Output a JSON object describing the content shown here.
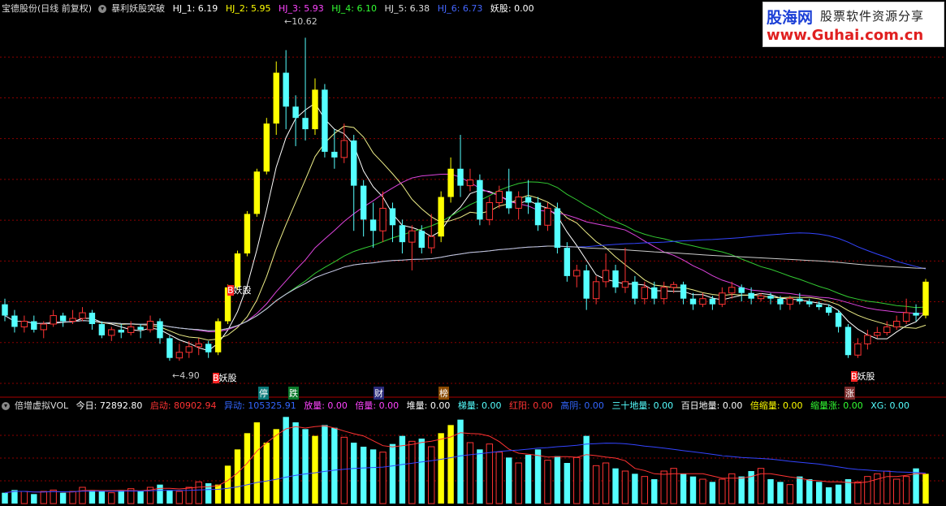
{
  "header": {
    "stock_name": "宝德股份(日线 前复权)",
    "menu_icon": "circle-menu-icon",
    "indicator_name": "暴利妖股突破",
    "hj1": {
      "label": "HJ_1: 6.19",
      "color": "#ffffff"
    },
    "hj2": {
      "label": "HJ_2: 5.95",
      "color": "#ffff00"
    },
    "hj3": {
      "label": "HJ_3: 5.93",
      "color": "#ff44ff"
    },
    "hj4": {
      "label": "HJ_4: 6.10",
      "color": "#33ff33"
    },
    "hj5": {
      "label": "HJ_5: 6.38",
      "color": "#dddddd"
    },
    "hj6": {
      "label": "HJ_6: 6.73",
      "color": "#4466ff"
    },
    "yaogu": {
      "label": "妖股: 0.00",
      "color": "#ffffff"
    }
  },
  "logo": {
    "line1": "股海网",
    "line2": "股票软件资源分享",
    "line3": "www.Guhai.com.cn"
  },
  "annotations": {
    "high_price": "10.62",
    "low_price": "4.90",
    "signal_yaogu": "妖股",
    "signal_b": "B",
    "tag_ting": "停",
    "tag_die": "跌",
    "tag_cai": "财",
    "tag_bang": "榜",
    "tag_zhang": "涨"
  },
  "volume_header": {
    "name": "倍增虚拟VOL",
    "today": "今日: 72892.80",
    "qidong": "启动: 80902.94",
    "yidong": "异动: 105325.91",
    "fangliang": "放量: 0.00",
    "beiliang": "倍量: 0.00",
    "duiliang": "堆量: 0.00",
    "tiliang": "梯量: 0.00",
    "hongyang": "红阳: 0.00",
    "gaoyin": "高阴: 0.00",
    "sanshi": "三十地量: 0.00",
    "baiday": "百日地量: 0.00",
    "beisuo": "倍缩量: 0.00",
    "suozhang": "缩量涨: 0.00",
    "xg": "XG: 0.00"
  },
  "colors": {
    "up": "#ff3333",
    "down": "#55ffff",
    "yellow": "#ffff00",
    "ma_white": "#ffffff",
    "ma_yellow": "#eeee88",
    "ma_magenta": "#dd44dd",
    "ma_green": "#33cc33",
    "ma_blue": "#3344ff",
    "ma_long": "#cccccc",
    "grid": "#8b0000"
  },
  "chart_data": {
    "type": "candlestick",
    "price_range": [
      4.5,
      11.0
    ],
    "highest": 10.62,
    "lowest": 4.9,
    "candles": [
      [
        5.9,
        5.7,
        6.0,
        5.6
      ],
      [
        5.7,
        5.5,
        5.8,
        5.4
      ],
      [
        5.5,
        5.6,
        5.7,
        5.4
      ],
      [
        5.6,
        5.45,
        5.7,
        5.4
      ],
      [
        5.45,
        5.55,
        5.6,
        5.3
      ],
      [
        5.55,
        5.7,
        5.8,
        5.5
      ],
      [
        5.7,
        5.6,
        5.75,
        5.5
      ],
      [
        5.6,
        5.65,
        5.8,
        5.55
      ],
      [
        5.65,
        5.75,
        5.85,
        5.6
      ],
      [
        5.75,
        5.55,
        5.8,
        5.45
      ],
      [
        5.55,
        5.35,
        5.6,
        5.3
      ],
      [
        5.35,
        5.45,
        5.5,
        5.25
      ],
      [
        5.45,
        5.4,
        5.55,
        5.3
      ],
      [
        5.4,
        5.5,
        5.6,
        5.35
      ],
      [
        5.5,
        5.45,
        5.55,
        5.3
      ],
      [
        5.45,
        5.6,
        5.7,
        5.4
      ],
      [
        5.6,
        5.3,
        5.65,
        5.2
      ],
      [
        5.3,
        4.95,
        5.35,
        4.9
      ],
      [
        4.95,
        5.05,
        5.2,
        4.9
      ],
      [
        5.05,
        5.15,
        5.25,
        4.95
      ],
      [
        5.15,
        5.2,
        5.3,
        5.0
      ],
      [
        5.2,
        5.05,
        5.25,
        4.95
      ],
      [
        5.05,
        5.6,
        5.65,
        5.0
      ],
      [
        5.6,
        6.2,
        6.25,
        5.55
      ],
      [
        6.2,
        6.8,
        6.85,
        6.15
      ],
      [
        6.8,
        7.5,
        7.55,
        6.75
      ],
      [
        7.5,
        8.25,
        8.3,
        7.45
      ],
      [
        8.25,
        9.1,
        9.2,
        8.2
      ],
      [
        9.1,
        10.0,
        10.2,
        8.9
      ],
      [
        10.0,
        9.4,
        10.4,
        9.0
      ],
      [
        9.4,
        9.2,
        9.6,
        8.7
      ],
      [
        9.2,
        9.0,
        10.62,
        8.8
      ],
      [
        9.0,
        9.7,
        9.9,
        8.9
      ],
      [
        9.7,
        8.6,
        9.8,
        8.5
      ],
      [
        8.6,
        8.5,
        9.0,
        8.3
      ],
      [
        8.5,
        8.8,
        9.1,
        8.4
      ],
      [
        8.8,
        8.0,
        8.9,
        7.2
      ],
      [
        8.0,
        7.4,
        8.1,
        7.1
      ],
      [
        7.4,
        7.2,
        7.7,
        6.9
      ],
      [
        7.2,
        7.6,
        7.9,
        7.0
      ],
      [
        7.6,
        7.3,
        7.7,
        7.0
      ],
      [
        7.3,
        7.0,
        7.4,
        6.8
      ],
      [
        7.0,
        7.2,
        7.3,
        6.5
      ],
      [
        7.2,
        6.9,
        7.3,
        6.8
      ],
      [
        6.9,
        7.1,
        7.5,
        6.8
      ],
      [
        7.1,
        7.8,
        7.9,
        7.0
      ],
      [
        7.8,
        8.3,
        8.5,
        7.7
      ],
      [
        8.3,
        8.0,
        8.9,
        7.8
      ],
      [
        8.0,
        8.1,
        8.3,
        7.9
      ],
      [
        8.1,
        7.4,
        8.2,
        7.3
      ],
      [
        7.4,
        7.7,
        7.8,
        7.3
      ],
      [
        7.7,
        7.9,
        8.0,
        7.6
      ],
      [
        7.9,
        7.6,
        8.3,
        7.5
      ],
      [
        7.6,
        7.8,
        7.9,
        7.4
      ],
      [
        7.8,
        7.7,
        8.1,
        7.5
      ],
      [
        7.7,
        7.3,
        7.8,
        7.2
      ],
      [
        7.3,
        7.6,
        7.7,
        7.2
      ],
      [
        7.6,
        6.9,
        7.7,
        6.8
      ],
      [
        6.9,
        6.4,
        7.0,
        6.3
      ],
      [
        6.4,
        6.5,
        6.6,
        6.2
      ],
      [
        6.5,
        6.0,
        6.6,
        5.8
      ],
      [
        6.0,
        6.3,
        6.4,
        5.9
      ],
      [
        6.3,
        6.5,
        6.8,
        6.2
      ],
      [
        6.5,
        6.2,
        6.6,
        6.1
      ],
      [
        6.2,
        6.3,
        6.9,
        6.1
      ],
      [
        6.3,
        6.0,
        6.4,
        5.9
      ],
      [
        6.0,
        6.2,
        6.3,
        5.9
      ],
      [
        6.2,
        6.0,
        6.3,
        5.9
      ],
      [
        6.0,
        6.2,
        6.3,
        5.9
      ],
      [
        6.2,
        6.25,
        6.3,
        6.1
      ],
      [
        6.25,
        6.0,
        6.3,
        5.9
      ],
      [
        6.0,
        5.9,
        6.1,
        5.8
      ],
      [
        5.9,
        6.0,
        6.1,
        5.85
      ],
      [
        6.0,
        5.9,
        6.05,
        5.8
      ],
      [
        5.9,
        6.1,
        6.2,
        5.85
      ],
      [
        6.1,
        6.2,
        6.3,
        6.0
      ],
      [
        6.2,
        6.1,
        6.25,
        5.95
      ],
      [
        6.1,
        6.0,
        6.2,
        5.9
      ],
      [
        6.0,
        6.05,
        6.1,
        5.95
      ],
      [
        6.05,
        6.0,
        6.1,
        5.9
      ],
      [
        6.0,
        5.9,
        6.05,
        5.8
      ],
      [
        5.9,
        6.0,
        6.05,
        5.8
      ],
      [
        6.0,
        5.95,
        6.1,
        5.9
      ],
      [
        5.95,
        5.9,
        6.0,
        5.85
      ],
      [
        5.9,
        5.85,
        5.95,
        5.8
      ],
      [
        5.85,
        5.75,
        5.9,
        5.7
      ],
      [
        5.75,
        5.5,
        5.8,
        5.4
      ],
      [
        5.5,
        5.0,
        5.55,
        4.95
      ],
      [
        5.0,
        5.2,
        5.3,
        4.95
      ],
      [
        5.2,
        5.35,
        5.45,
        5.1
      ],
      [
        5.35,
        5.4,
        5.5,
        5.3
      ],
      [
        5.4,
        5.5,
        5.6,
        5.35
      ],
      [
        5.5,
        5.6,
        5.7,
        5.45
      ],
      [
        5.6,
        5.75,
        6.0,
        5.55
      ],
      [
        5.75,
        5.7,
        5.9,
        5.6
      ],
      [
        5.7,
        6.3,
        6.35,
        5.65
      ]
    ],
    "volume": [
      8,
      10,
      9,
      7,
      9,
      10,
      8,
      9,
      12,
      10,
      9,
      8,
      10,
      11,
      9,
      12,
      14,
      10,
      9,
      12,
      16,
      15,
      14,
      28,
      40,
      52,
      60,
      45,
      55,
      64,
      60,
      55,
      50,
      58,
      56,
      49,
      45,
      42,
      40,
      38,
      44,
      50,
      46,
      48,
      42,
      52,
      58,
      62,
      45,
      40,
      44,
      38,
      34,
      30,
      36,
      40,
      32,
      35,
      30,
      34,
      50,
      28,
      30,
      26,
      24,
      22,
      20,
      18,
      24,
      26,
      22,
      20,
      18,
      16,
      18,
      22,
      20,
      24,
      26,
      18,
      16,
      14,
      20,
      18,
      16,
      12,
      14,
      18,
      16,
      20,
      22,
      24,
      18,
      20,
      26,
      22
    ]
  }
}
